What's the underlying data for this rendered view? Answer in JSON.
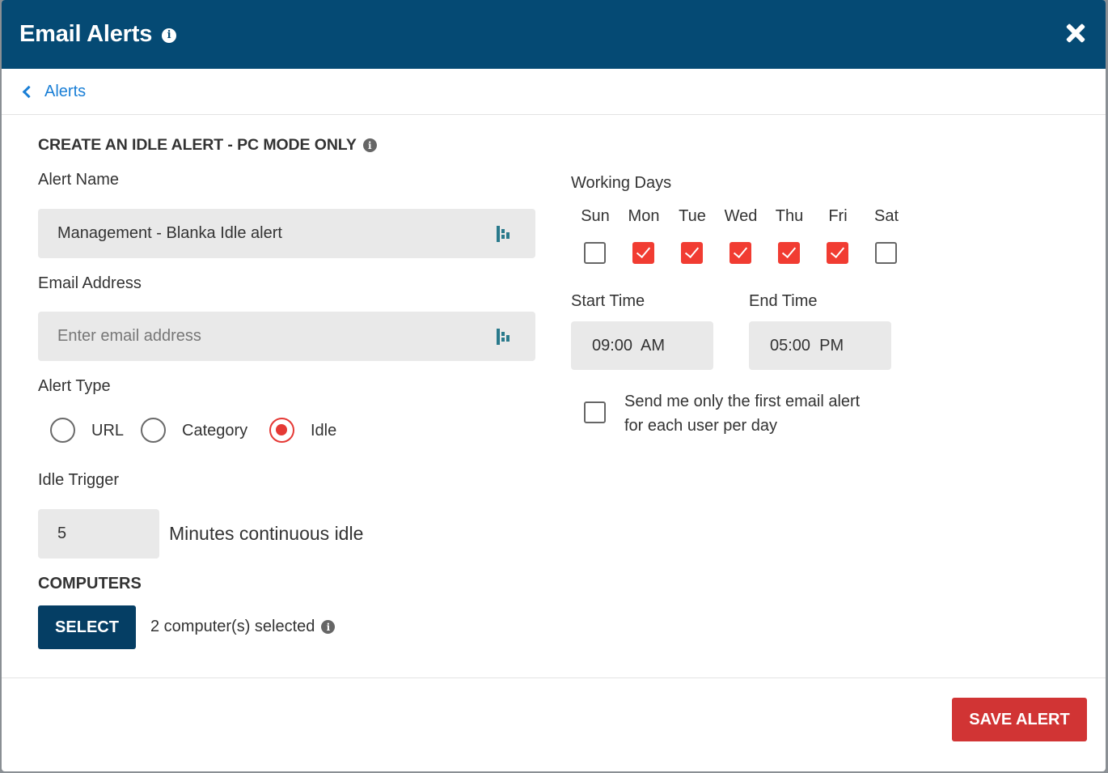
{
  "header": {
    "title": "Email Alerts",
    "info_glyph": "i"
  },
  "breadcrumb": {
    "back_label": "Alerts"
  },
  "section": {
    "title": "CREATE AN IDLE ALERT - PC MODE ONLY",
    "info_glyph": "i"
  },
  "alert_name": {
    "label": "Alert Name",
    "value": "Management - Blanka Idle alert"
  },
  "email": {
    "label": "Email Address",
    "placeholder": "Enter email address",
    "value": ""
  },
  "alert_type": {
    "label": "Alert Type",
    "options": [
      {
        "label": "URL",
        "selected": false
      },
      {
        "label": "Category",
        "selected": false
      },
      {
        "label": "Idle",
        "selected": true
      }
    ]
  },
  "idle_trigger": {
    "label": "Idle Trigger",
    "value": "5",
    "suffix": "Minutes continuous idle"
  },
  "computers": {
    "label": "COMPUTERS",
    "select_label": "SELECT",
    "status": "2 computer(s) selected",
    "info_glyph": "i"
  },
  "working_days": {
    "label": "Working Days",
    "days": [
      {
        "label": "Sun",
        "checked": false
      },
      {
        "label": "Mon",
        "checked": true
      },
      {
        "label": "Tue",
        "checked": true
      },
      {
        "label": "Wed",
        "checked": true
      },
      {
        "label": "Thu",
        "checked": true
      },
      {
        "label": "Fri",
        "checked": true
      },
      {
        "label": "Sat",
        "checked": false
      }
    ]
  },
  "start_time": {
    "label": "Start Time",
    "value": "09:00  AM"
  },
  "end_time": {
    "label": "End Time",
    "value": "05:00  PM"
  },
  "first_alert": {
    "line1": "Send me only the first email alert",
    "line2": "for each user per day",
    "checked": false
  },
  "footer": {
    "save_label": "SAVE ALERT"
  },
  "colors": {
    "header_bg": "#054a74",
    "accent_red": "#f13c32",
    "link_blue": "#1a7fd6",
    "save_bg": "#d13434",
    "select_bg": "#053e64"
  }
}
